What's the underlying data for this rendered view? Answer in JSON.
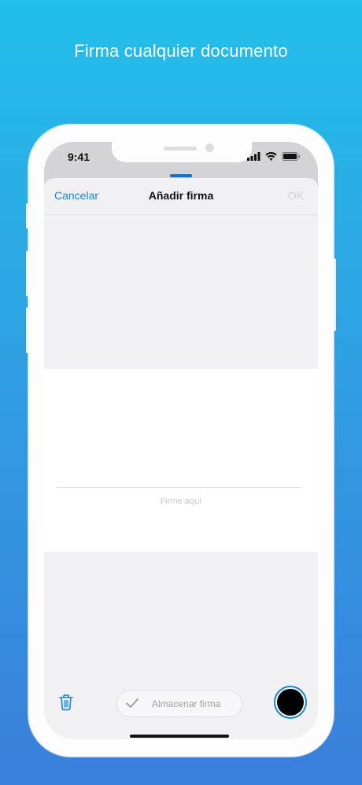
{
  "headline": "Firma cualquier documento",
  "status_bar": {
    "time": "9:41",
    "icons": [
      "signal-icon",
      "wifi-icon",
      "battery-icon"
    ]
  },
  "nav": {
    "cancel_label": "Cancelar",
    "title": "Añadir firma",
    "ok_label": "OK"
  },
  "signature_pad": {
    "hint": "Firme aquí"
  },
  "toolbar": {
    "trash_icon": "trash-icon",
    "store_label": "Almacenar firma",
    "store_icon": "checkmark-icon",
    "selected_color": "#000000"
  },
  "colors": {
    "accent": "#1a86c8",
    "background_top": "#22bfea",
    "background_bottom": "#3a7fdc"
  }
}
